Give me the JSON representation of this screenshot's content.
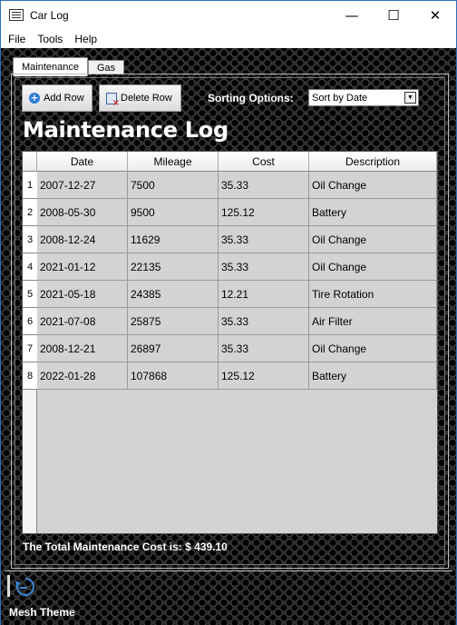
{
  "window": {
    "title": "Car Log",
    "minimize": "—",
    "maximize": "☐",
    "close": "✕"
  },
  "menu": [
    "File",
    "Tools",
    "Help"
  ],
  "tabs": [
    {
      "label": "Maintenance",
      "active": true
    },
    {
      "label": "Gas",
      "active": false
    }
  ],
  "toolbar": {
    "add_label": "Add Row",
    "delete_label": "Delete Row",
    "sort_label": "Sorting Options:",
    "sort_value": "Sort by Date"
  },
  "page_title": "Maintenance Log",
  "table": {
    "columns": [
      "Date",
      "Mileage",
      "Cost",
      "Description"
    ],
    "rows": [
      {
        "num": "1",
        "cells": [
          "2007-12-27",
          "7500",
          "35.33",
          "Oil Change"
        ]
      },
      {
        "num": "2",
        "cells": [
          "2008-05-30",
          "9500",
          "125.12",
          "Battery"
        ]
      },
      {
        "num": "3",
        "cells": [
          "2008-12-24",
          "11629",
          "35.33",
          "Oil Change"
        ]
      },
      {
        "num": "4",
        "cells": [
          "2021-01-12",
          "22135",
          "35.33",
          "Oil Change"
        ]
      },
      {
        "num": "5",
        "cells": [
          "2021-05-18",
          "24385",
          "12.21",
          "Tire Rotation"
        ]
      },
      {
        "num": "6",
        "cells": [
          "2021-07-08",
          "25875",
          "35.33",
          "Air Filter"
        ]
      },
      {
        "num": "7",
        "cells": [
          "2008-12-21",
          "26897",
          "35.33",
          "Oil Change"
        ]
      },
      {
        "num": "8",
        "cells": [
          "2022-01-28",
          "107868",
          "125.12",
          "Battery"
        ]
      }
    ]
  },
  "total_text": "The Total Maintenance Cost is: $  439.10",
  "theme_label": "Mesh Theme",
  "colors": {
    "accent": "#2a7bd6",
    "window_border": "#2f6fb7",
    "table_bg": "#d3d3d3"
  }
}
